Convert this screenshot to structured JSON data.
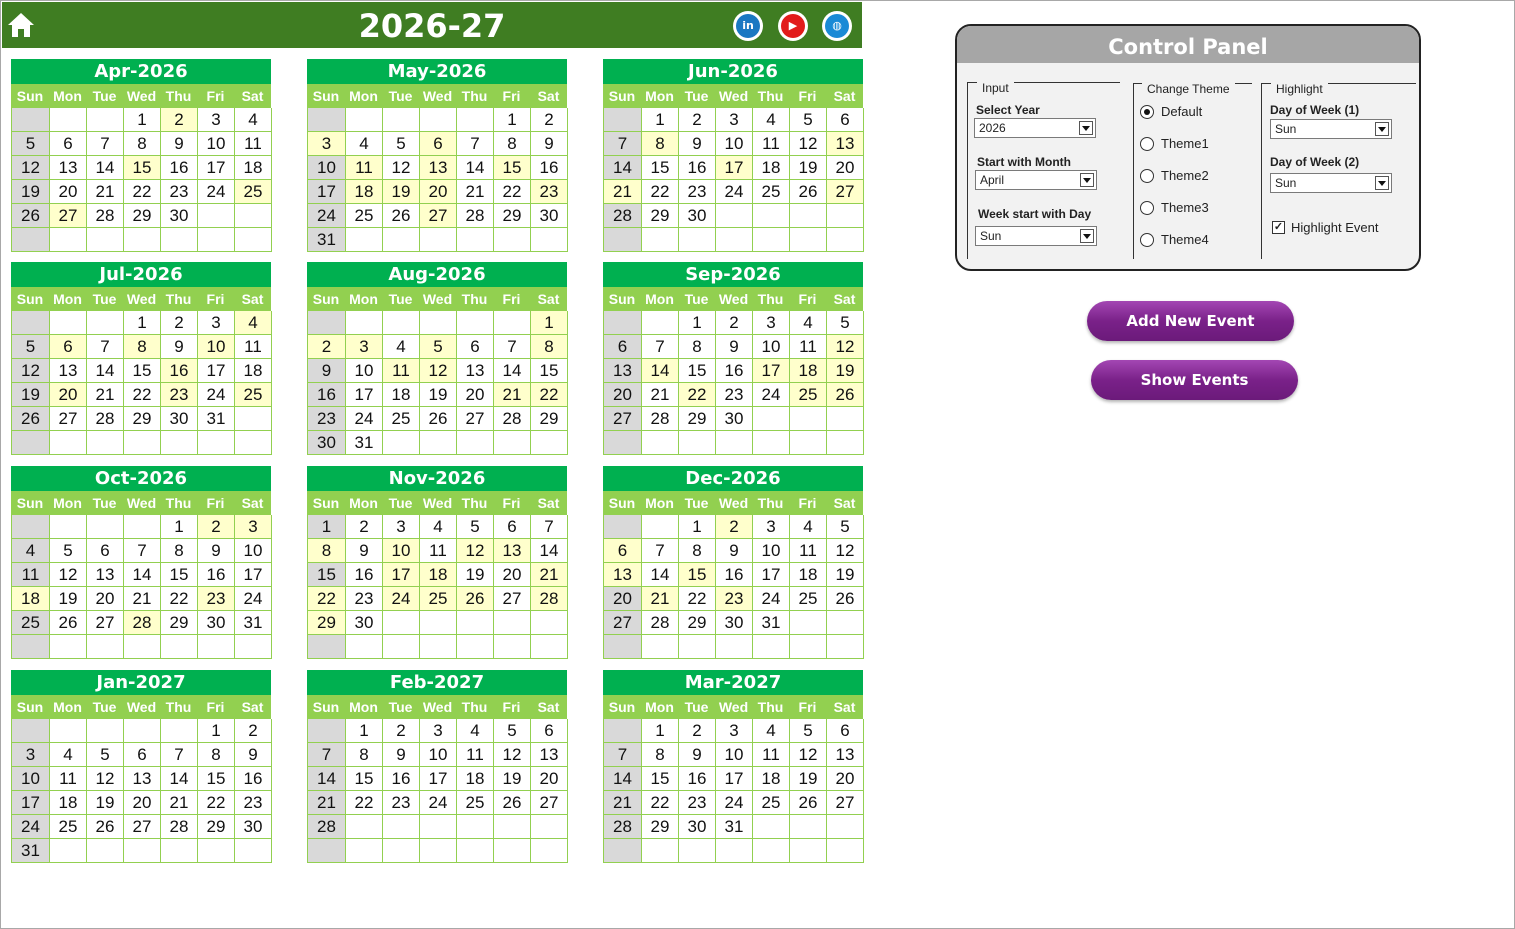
{
  "header": {
    "title": "2026-27",
    "home_icon": "home-icon",
    "social": [
      {
        "label": "in",
        "icon": "linkedin-icon",
        "color": "#1a78c2"
      },
      {
        "label": "▶",
        "icon": "youtube-icon",
        "color": "#e21b1b"
      },
      {
        "label": "◍",
        "icon": "globe-icon",
        "color": "#1a8ad6"
      }
    ]
  },
  "colors": {
    "header_bg": "#3f7d22",
    "month_title_bg": "#00b050",
    "weekday_bg": "#92d050",
    "sunday_cell": "#d9d9d9",
    "highlight_cell": "#ffffcc",
    "button": "#7a2189"
  },
  "calendar": {
    "weekdays": [
      "Sun",
      "Mon",
      "Tue",
      "Wed",
      "Thu",
      "Fri",
      "Sat"
    ],
    "months": [
      {
        "name": "Apr-2026",
        "start": 3,
        "days": 30,
        "highlights": [
          2,
          15,
          25,
          27
        ]
      },
      {
        "name": "May-2026",
        "start": 5,
        "days": 31,
        "highlights": [
          3,
          6,
          11,
          13,
          15,
          18,
          19,
          20,
          23,
          27
        ]
      },
      {
        "name": "Jun-2026",
        "start": 1,
        "days": 30,
        "highlights": [
          8,
          13,
          17,
          21,
          27
        ]
      },
      {
        "name": "Jul-2026",
        "start": 3,
        "days": 31,
        "highlights": [
          4,
          6,
          8,
          10,
          16,
          20,
          23,
          25
        ]
      },
      {
        "name": "Aug-2026",
        "start": 6,
        "days": 31,
        "highlights": [
          1,
          2,
          3,
          5,
          8,
          11,
          12,
          21,
          22
        ]
      },
      {
        "name": "Sep-2026",
        "start": 2,
        "days": 30,
        "highlights": [
          12,
          14,
          17,
          18,
          19,
          22,
          25,
          26
        ]
      },
      {
        "name": "Oct-2026",
        "start": 4,
        "days": 31,
        "highlights": [
          2,
          3,
          18,
          23,
          28
        ]
      },
      {
        "name": "Nov-2026",
        "start": 0,
        "days": 30,
        "highlights": [
          8,
          10,
          12,
          13,
          17,
          18,
          21,
          22,
          24,
          25,
          26,
          28,
          29
        ]
      },
      {
        "name": "Dec-2026",
        "start": 2,
        "days": 31,
        "highlights": [
          2,
          6,
          13,
          15,
          21,
          23
        ]
      },
      {
        "name": "Jan-2027",
        "start": 5,
        "days": 31,
        "highlights": []
      },
      {
        "name": "Feb-2027",
        "start": 1,
        "days": 28,
        "highlights": []
      },
      {
        "name": "Mar-2027",
        "start": 1,
        "days": 31,
        "highlights": []
      }
    ]
  },
  "control_panel": {
    "title": "Control Panel",
    "input": {
      "group_label": "Input",
      "year_label": "Select Year",
      "year_value": "2026",
      "month_label": "Start with Month",
      "month_value": "April",
      "week_label": "Week start with Day",
      "week_value": "Sun"
    },
    "theme": {
      "group_label": "Change Theme",
      "options": [
        "Default",
        "Theme1",
        "Theme2",
        "Theme3",
        "Theme4"
      ],
      "selected": "Default"
    },
    "highlight": {
      "group_label": "Highlight",
      "dow1_label": "Day of Week (1)",
      "dow1_value": "Sun",
      "dow2_label": "Day of Week (2)",
      "dow2_value": "Sun",
      "event_label": "Highlight  Event",
      "event_checked": true
    }
  },
  "buttons": {
    "add_event": "Add New Event",
    "show_events": "Show Events"
  }
}
